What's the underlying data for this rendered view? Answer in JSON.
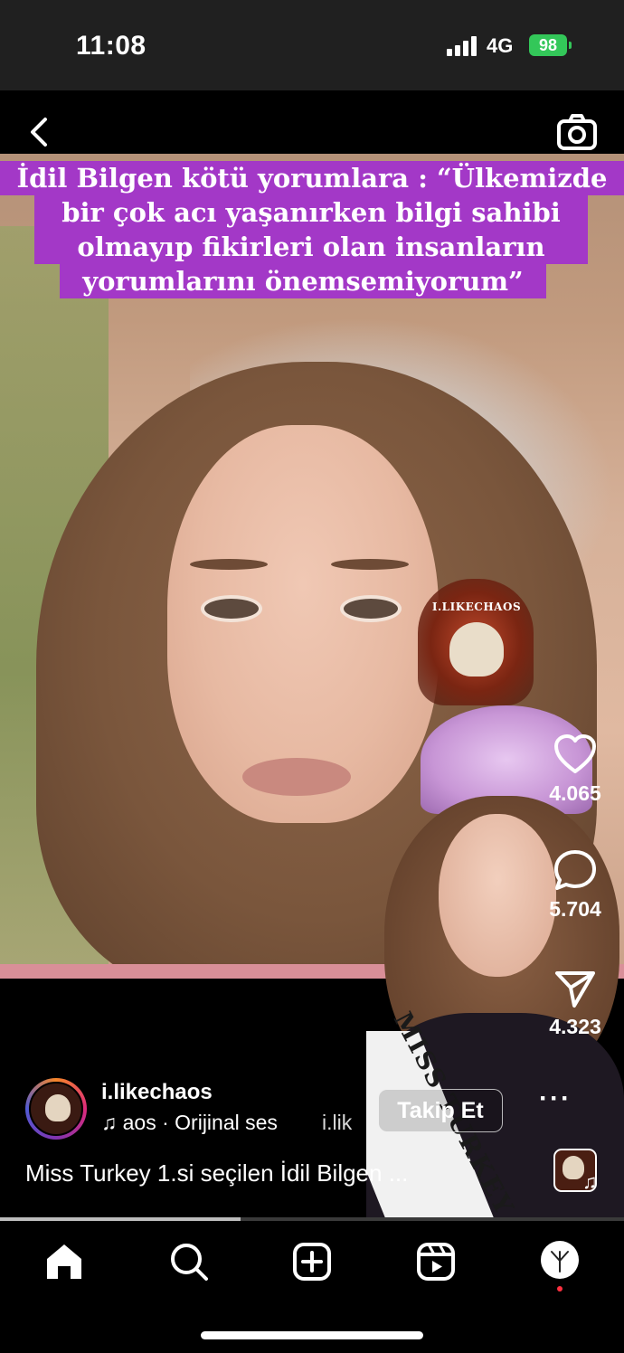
{
  "status_bar": {
    "time": "11:08",
    "network": "4G",
    "battery": "98"
  },
  "header": {
    "back_icon": "chevron-left-icon",
    "camera_icon": "camera-icon"
  },
  "video_caption_lines": [
    "İdil Bilgen kötü yorumlara : “Ülkemizde",
    "bir çok acı yaşanırken bilgi sahibi",
    "olmayıp fikirleri olan insanların",
    "yorumlarını önemsemiyorum”"
  ],
  "overlay": {
    "sticker_label": "I.LIKECHAOS",
    "sash_text": "MISS TURKEY"
  },
  "actions": {
    "likes": "4.065",
    "comments": "5.704",
    "shares": "4.323"
  },
  "post": {
    "username": "i.likechaos",
    "audio": "aos · Orijinal ses",
    "audio_scroll": "i.lik",
    "follow_label": "Takip Et",
    "more_label": "···",
    "caption": "Miss Turkey 1.si seçilen İdil Bilgen ..."
  },
  "progress": {
    "fraction": 0.385
  },
  "nav": {
    "items": [
      "home-icon",
      "search-icon",
      "create-icon",
      "reels-icon",
      "profile-avatar"
    ]
  },
  "colors": {
    "caption_bg": "#a338c7",
    "battery": "#33c759",
    "notification_dot": "#ff3040"
  }
}
